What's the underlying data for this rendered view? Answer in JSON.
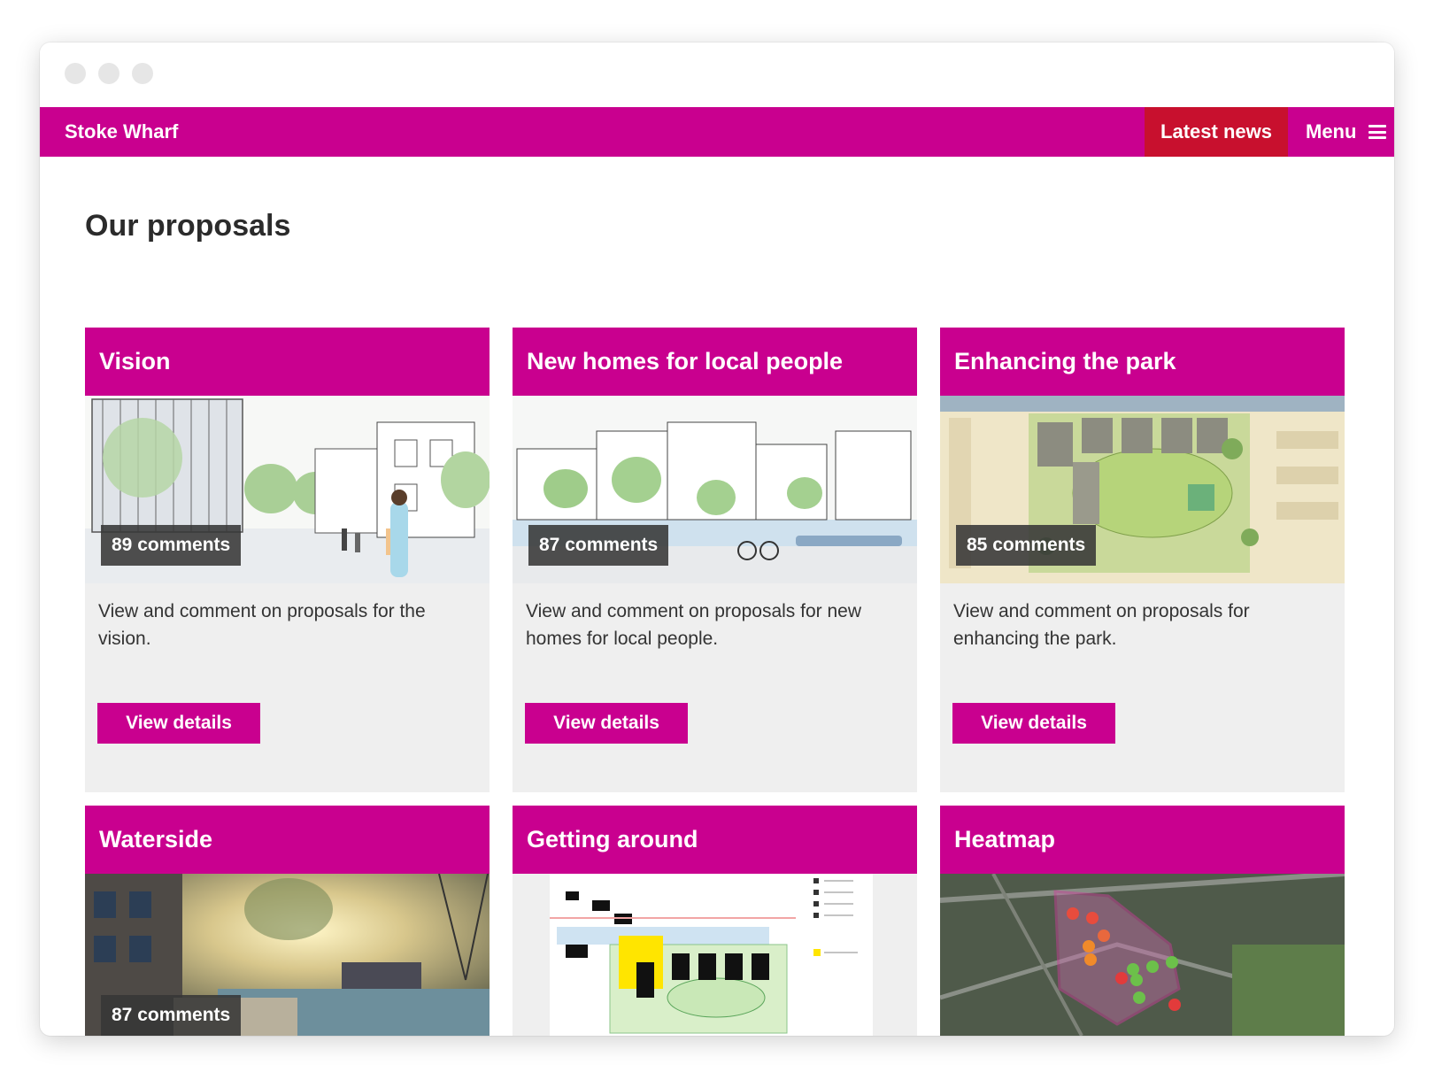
{
  "nav": {
    "brand": "Stoke Wharf",
    "latest_news": "Latest news",
    "menu": "Menu"
  },
  "page": {
    "title": "Our proposals"
  },
  "cards": [
    {
      "title": "Vision",
      "comments": "89 comments",
      "description": "View and comment on proposals for the vision.",
      "button": "View details"
    },
    {
      "title": "New homes for local people",
      "comments": "87 comments",
      "description": "View and comment on proposals for new homes for local people.",
      "button": "View details"
    },
    {
      "title": "Enhancing the park",
      "comments": "85 comments",
      "description": "View and comment on proposals for enhancing the park.",
      "button": "View details"
    },
    {
      "title": "Waterside",
      "comments": "87 comments"
    },
    {
      "title": "Getting around"
    },
    {
      "title": "Heatmap"
    }
  ],
  "colors": {
    "brand_magenta": "#c9008f",
    "news_red": "#c8102e",
    "card_bg": "#efefef"
  }
}
